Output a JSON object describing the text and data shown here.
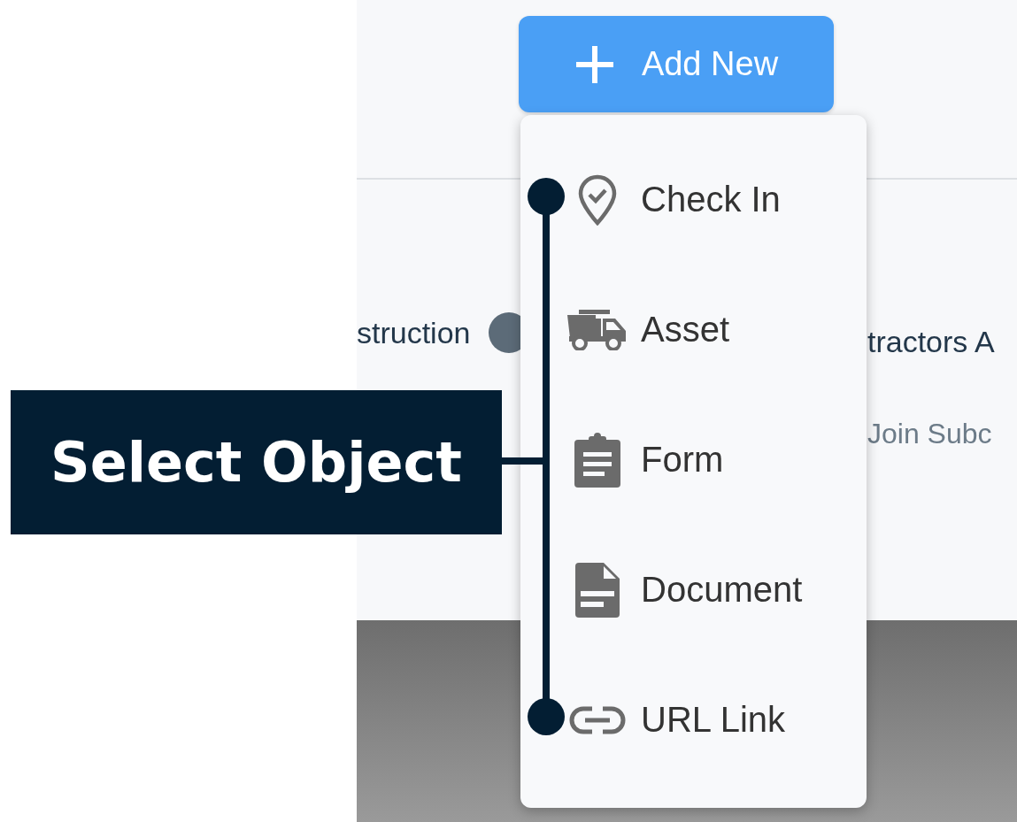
{
  "add_button": {
    "label": "Add New"
  },
  "page_content": {
    "left_text": "struction",
    "right_title": "tractors A",
    "right_subtitle": "Join Subc"
  },
  "menu": {
    "items": [
      {
        "label": "Check In",
        "kind": "checkin"
      },
      {
        "label": "Asset",
        "kind": "asset"
      },
      {
        "label": "Form",
        "kind": "form"
      },
      {
        "label": "Document",
        "kind": "document"
      },
      {
        "label": "URL Link",
        "kind": "link"
      }
    ]
  },
  "callout": {
    "label": "Select Object"
  }
}
